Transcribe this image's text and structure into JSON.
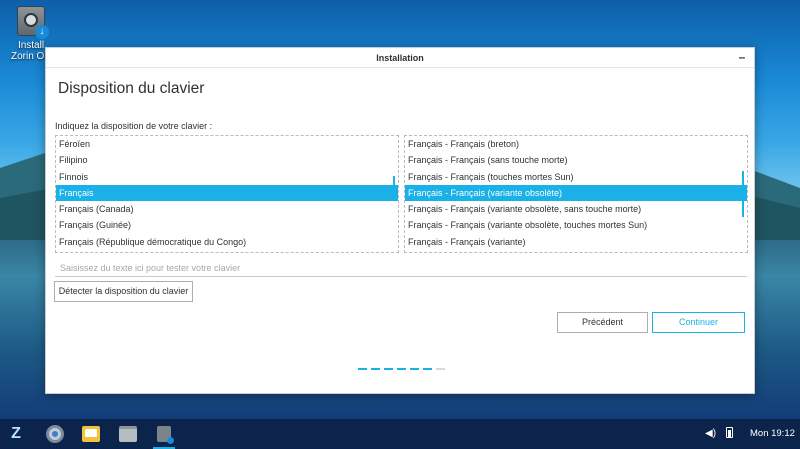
{
  "desktop": {
    "icon_label": "Install Zorin OS"
  },
  "window": {
    "title": "Installation",
    "minimize_symbol": "–",
    "page_title": "Disposition du clavier",
    "instruction": "Indiquez la disposition de votre clavier :",
    "layouts": [
      "Féroïen",
      "Filipino",
      "Finnois",
      "Français",
      "Français (Canada)",
      "Français (Guinée)",
      "Français (République démocratique du Congo)"
    ],
    "selected_layout": "Français",
    "variants": [
      "Français - Français (breton)",
      "Français - Français (sans touche morte)",
      "Français - Français (touches mortes Sun)",
      "Français - Français (variante obsolète)",
      "Français - Français (variante obsolète, sans touche morte)",
      "Français - Français (variante obsolète, touches mortes Sun)",
      "Français - Français (variante)"
    ],
    "selected_variant": "Français - Français (variante obsolète)",
    "test_placeholder": "Saisissez du texte ici pour tester votre clavier",
    "detect_button": "Détecter la disposition du clavier",
    "back_button": "Précédent",
    "next_button": "Continuer",
    "progress_steps_total": 7,
    "progress_steps_done": 6
  },
  "taskbar": {
    "apps": [
      "zorin-menu-icon",
      "chromium-icon",
      "mail-icon",
      "files-icon",
      "installer-icon"
    ],
    "clock": "Mon 19:12"
  },
  "colors": {
    "accent": "#1ab0e8",
    "taskbar": "#0a2046"
  }
}
